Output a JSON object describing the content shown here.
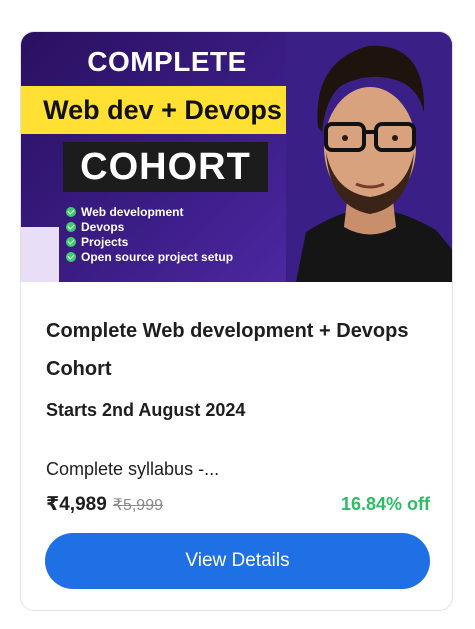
{
  "banner": {
    "title_top": "COMPLETE",
    "highlight": "Web dev + Devops",
    "cohort": "COHORT",
    "features": [
      "Web development",
      "Devops",
      "Projects",
      "Open source project setup"
    ],
    "feature_icon": "check-circle-icon",
    "accent_yellow": "#ffe033",
    "background": "#3b1d86"
  },
  "course": {
    "title": "Complete Web development + Devops Cohort",
    "start_date": "Starts 2nd August 2024",
    "syllabus": "Complete syllabus -...",
    "price": "₹4,989",
    "mrp": "₹5,999",
    "discount": "16.84% off",
    "discount_color": "#2dbd64"
  },
  "actions": {
    "view_details_label": "View Details",
    "button_color": "#1f6fe5"
  }
}
